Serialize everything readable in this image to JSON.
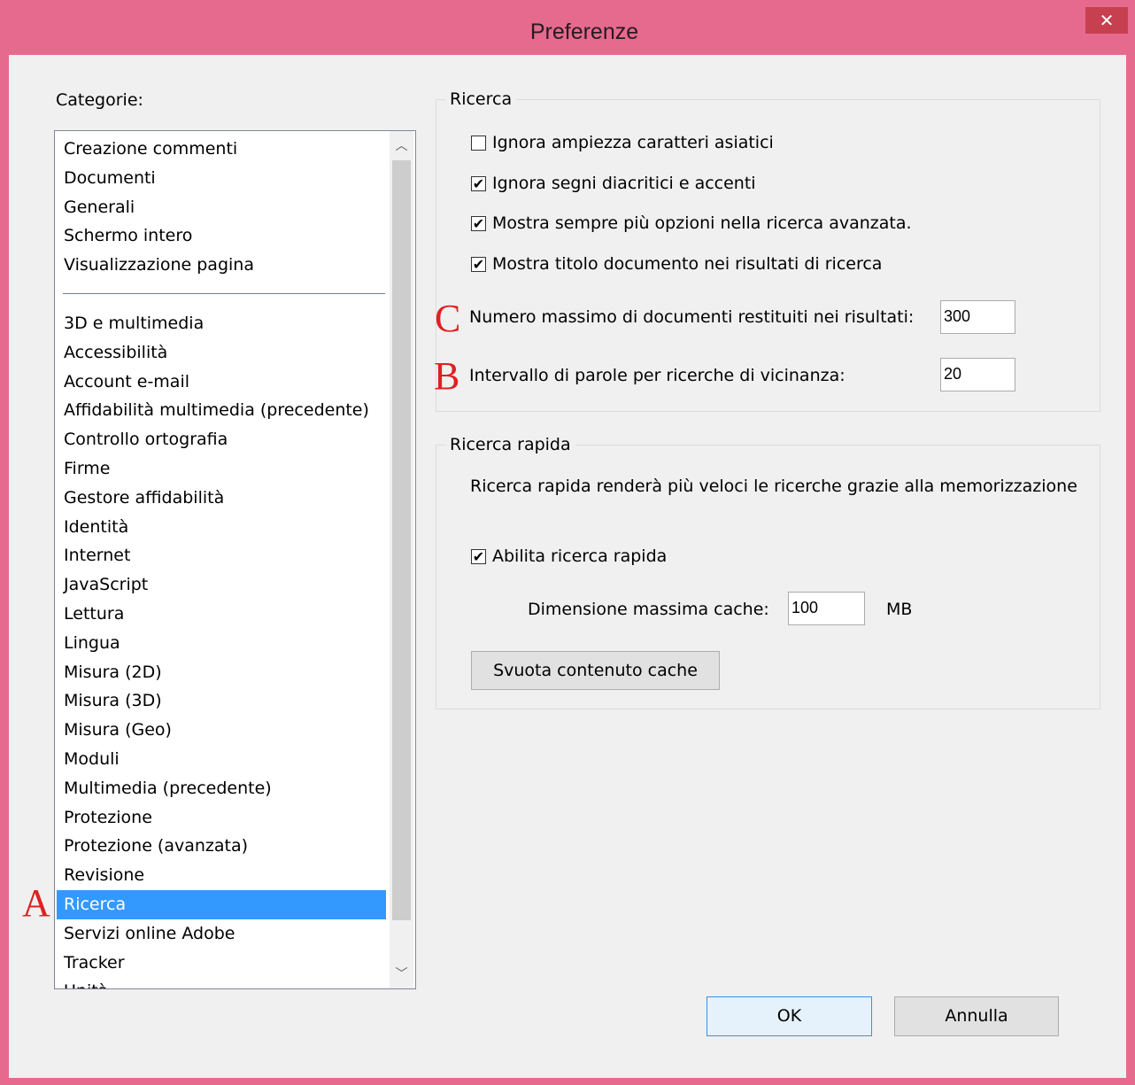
{
  "window": {
    "title": "Preferenze",
    "close_glyph": "✕"
  },
  "categories": {
    "label": "Categorie:",
    "items_top": [
      "Creazione commenti",
      "Documenti",
      "Generali",
      "Schermo intero",
      "Visualizzazione pagina"
    ],
    "items": [
      "3D e multimedia",
      "Accessibilità",
      "Account e-mail",
      "Affidabilità multimedia (precedente)",
      "Controllo ortografia",
      "Firme",
      "Gestore affidabilità",
      "Identità",
      "Internet",
      "JavaScript",
      "Lettura",
      "Lingua",
      "Misura (2D)",
      "Misura (3D)",
      "Misura (Geo)",
      "Moduli",
      "Multimedia (precedente)",
      "Protezione",
      "Protezione (avanzata)",
      "Revisione",
      "Ricerca",
      "Servizi online Adobe",
      "Tracker",
      "Unità"
    ],
    "selected": "Ricerca",
    "scroll_up_glyph": "︿",
    "scroll_down_glyph": "﹀"
  },
  "search": {
    "group_title": "Ricerca",
    "ignore_asian_width": {
      "label": "Ignora ampiezza caratteri asiatici",
      "checked": false
    },
    "ignore_diacritics": {
      "label": "Ignora segni diacritici e accenti",
      "checked": true
    },
    "show_more_options": {
      "label": "Mostra sempre più opzioni nella ricerca avanzata.",
      "checked": true
    },
    "show_doc_title": {
      "label": "Mostra titolo documento nei risultati di ricerca",
      "checked": true
    },
    "max_docs_label": "Numero massimo di documenti restituiti nei risultati:",
    "max_docs_value": "300",
    "word_range_label": "Intervallo di parole per ricerche di vicinanza:",
    "word_range_value": "20"
  },
  "fast_search": {
    "group_title": "Ricerca rapida",
    "description": "Ricerca rapida renderà più veloci le ricerche grazie alla memorizzazione",
    "enable": {
      "label": "Abilita ricerca rapida",
      "checked": true
    },
    "cache_label": "Dimensione massima cache:",
    "cache_value": "100",
    "cache_unit": "MB",
    "clear_button": "Svuota contenuto cache"
  },
  "buttons": {
    "ok": "OK",
    "cancel": "Annulla"
  },
  "annotations": {
    "a": "A",
    "b": "B",
    "c": "C"
  },
  "colors": {
    "title_bar": "#e56a8e",
    "close_button": "#c7404f",
    "selection": "#3399ff",
    "marker": "#e02020"
  }
}
